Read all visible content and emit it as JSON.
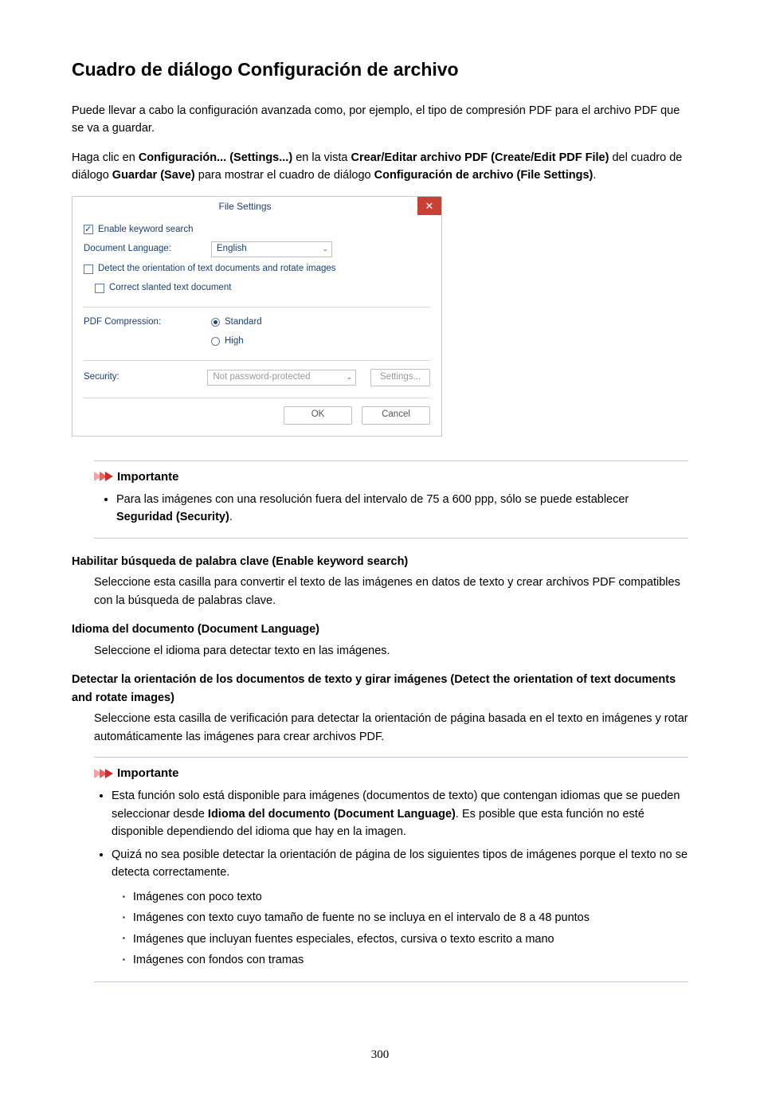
{
  "title": "Cuadro de diálogo Configuración de archivo",
  "intro1": "Puede llevar a cabo la configuración avanzada como, por ejemplo, el tipo de compresión PDF para el archivo PDF que se va a guardar.",
  "intro2": {
    "prefix": "Haga clic en ",
    "bold1": "Configuración... (Settings...)",
    "mid1": " en la vista ",
    "bold2": "Crear/Editar archivo PDF (Create/Edit PDF File)",
    "mid2": " del cuadro de diálogo ",
    "bold3": "Guardar (Save)",
    "mid3": " para mostrar el cuadro de diálogo ",
    "bold4": "Configuración de archivo (File Settings)",
    "suffix": "."
  },
  "dialog": {
    "title": "File Settings",
    "close": "✕",
    "enable_keyword_label": "Enable keyword search",
    "doc_lang_label": "Document Language:",
    "doc_lang_value": "English",
    "detect_label": "Detect the orientation of text documents and rotate images",
    "correct_label": "Correct slanted text document",
    "pdf_comp_label": "PDF Compression:",
    "comp_standard": "Standard",
    "comp_high": "High",
    "security_label": "Security:",
    "security_value": "Not password-protected",
    "settings_btn": "Settings...",
    "ok": "OK",
    "cancel": "Cancel"
  },
  "important_word": "Importante",
  "important1": {
    "text1": "Para las imágenes con una resolución fuera del intervalo de 75 a 600 ppp, sólo se puede establecer ",
    "bold": "Seguridad (Security)",
    "text2": "."
  },
  "defs": {
    "d1": {
      "term": "Habilitar búsqueda de palabra clave (Enable keyword search)",
      "desc": "Seleccione esta casilla para convertir el texto de las imágenes en datos de texto y crear archivos PDF compatibles con la búsqueda de palabras clave."
    },
    "d2": {
      "term": "Idioma del documento (Document Language)",
      "desc": "Seleccione el idioma para detectar texto en las imágenes."
    },
    "d3": {
      "term": "Detectar la orientación de los documentos de texto y girar imágenes (Detect the orientation of text documents and rotate images)",
      "desc": "Seleccione esta casilla de verificación para detectar la orientación de página basada en el texto en imágenes y rotar automáticamente las imágenes para crear archivos PDF."
    }
  },
  "important2": {
    "li1": {
      "t1": "Esta función solo está disponible para imágenes (documentos de texto) que contengan idiomas que se pueden seleccionar desde ",
      "b": "Idioma del documento (Document Language)",
      "t2": ". Es posible que esta función no esté disponible dependiendo del idioma que hay en la imagen."
    },
    "li2": "Quizá no sea posible detectar la orientación de página de los siguientes tipos de imágenes porque el texto no se detecta correctamente.",
    "sub": [
      "Imágenes con poco texto",
      "Imágenes con texto cuyo tamaño de fuente no se incluya en el intervalo de 8 a 48 puntos",
      "Imágenes que incluyan fuentes especiales, efectos, cursiva o texto escrito a mano",
      "Imágenes con fondos con tramas"
    ]
  },
  "page_number": "300"
}
